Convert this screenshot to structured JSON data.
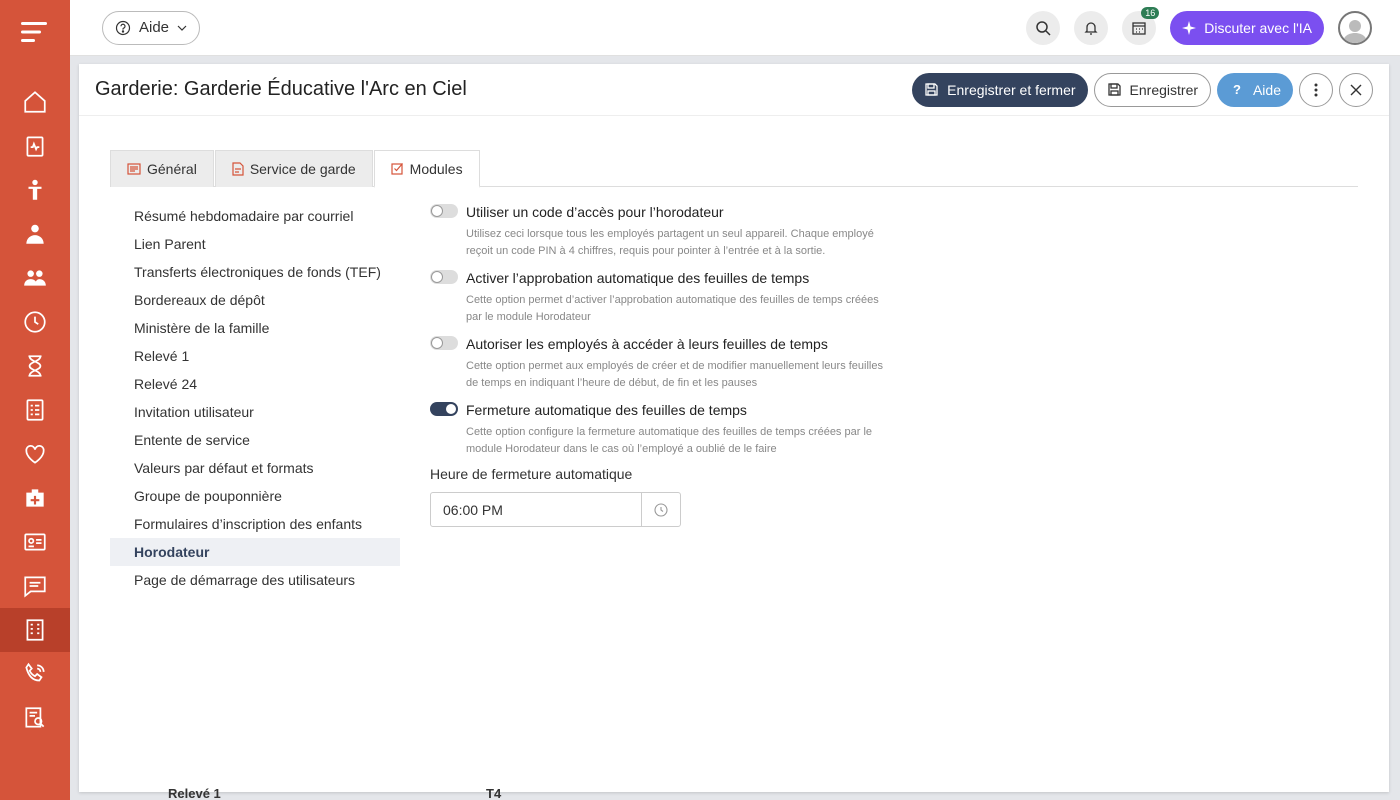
{
  "topbar": {
    "help_label": "Aide",
    "notif_count": "16",
    "ai_label": "Discuter avec l'IA"
  },
  "sidebar": {
    "items": [
      "home-icon",
      "clipboard-pulse-icon",
      "child-icon",
      "staff-icon",
      "group-icon",
      "clock-icon",
      "hourglass-icon",
      "checklist-icon",
      "heart-icon",
      "medical-kit-icon",
      "id-card-icon",
      "message-icon",
      "building-icon",
      "phone-icon",
      "report-icon"
    ],
    "active_index": 12
  },
  "panel": {
    "title": "Garderie: Garderie Éducative l'Arc en Ciel",
    "save_close_label": "Enregistrer et fermer",
    "save_label": "Enregistrer",
    "help_label": "Aide"
  },
  "tabs": [
    {
      "label": "Général"
    },
    {
      "label": "Service de garde"
    },
    {
      "label": "Modules"
    }
  ],
  "menu": [
    "Résumé hebdomadaire par courriel",
    "Lien Parent",
    "Transferts électroniques de fonds (TEF)",
    "Bordereaux de dépôt",
    "Ministère de la famille",
    "Relevé 1",
    "Relevé 24",
    "Invitation utilisateur",
    "Entente de service",
    "Valeurs par défaut et formats",
    "Groupe de pouponnière",
    "Formulaires d’inscription des enfants",
    "Horodateur",
    "Page de démarrage des utilisateurs"
  ],
  "options": [
    {
      "title": "Utiliser un code d’accès pour l’horodateur",
      "desc": "Utilisez ceci lorsque tous les employés partagent un seul appareil. Chaque employé reçoit un code PIN à 4 chiffres, requis pour pointer à l’entrée et à la sortie.",
      "on": false
    },
    {
      "title": "Activer l’approbation automatique des feuilles de temps",
      "desc": "Cette option permet d’activer l’approbation automatique des feuilles de temps créées par le module Horodateur",
      "on": false
    },
    {
      "title": "Autoriser les employés à accéder à leurs feuilles de temps",
      "desc": "Cette option permet aux employés de créer et de modifier manuellement leurs feuilles de temps en indiquant l’heure de début, de fin et les pauses",
      "on": false
    },
    {
      "title": "Fermeture automatique des feuilles de temps",
      "desc": "Cette option configure la fermeture automatique des feuilles de temps créées par le module Horodateur dans le cas où l’employé a oublié de le faire",
      "on": true
    }
  ],
  "auto_close": {
    "label": "Heure de fermeture automatique",
    "value": "06:00 PM"
  },
  "background": {
    "card1": "Relevé 1",
    "card2": "T4"
  }
}
